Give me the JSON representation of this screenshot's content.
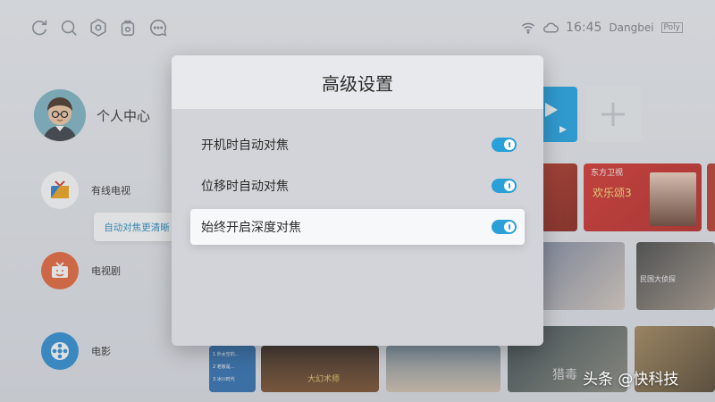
{
  "topbar": {
    "icons": [
      "refresh-icon",
      "search-icon",
      "settings-icon",
      "bag-icon",
      "message-icon"
    ],
    "time": "16:45",
    "brand": "Dangbei",
    "brand_logo": "Poly",
    "status_icons": [
      "wifi-icon",
      "cloud-icon"
    ]
  },
  "sidebar": {
    "profile_label": "个人中心",
    "items": [
      {
        "label": "有线电视",
        "icon": "tv-icon",
        "color": "#ffffff"
      },
      {
        "label": "电视剧",
        "icon": "tv-series-icon",
        "color": "#e8663a"
      },
      {
        "label": "电影",
        "icon": "film-reel-icon",
        "color": "#2e8fd5"
      }
    ],
    "tooltip": "自动对焦更清晰"
  },
  "tiles": {
    "row2": {
      "channel_logo": "东方卫视",
      "show_title": "欢乐颂3"
    },
    "row3": {
      "banner_text": "民国大侦探"
    },
    "row4": {
      "list": [
        "1 外太空的...",
        "2 老板是...",
        "3 冰川时代"
      ],
      "poster_text": "大幻术师",
      "poster2_text": "猎毒"
    }
  },
  "dialog": {
    "title": "高级设置",
    "options": [
      {
        "label": "开机时自动对焦",
        "enabled": true
      },
      {
        "label": "位移时自动对焦",
        "enabled": true
      },
      {
        "label": "始终开启深度对焦",
        "enabled": true
      }
    ],
    "accent_color": "#29a0d8"
  },
  "watermark": "头条 @快科技"
}
